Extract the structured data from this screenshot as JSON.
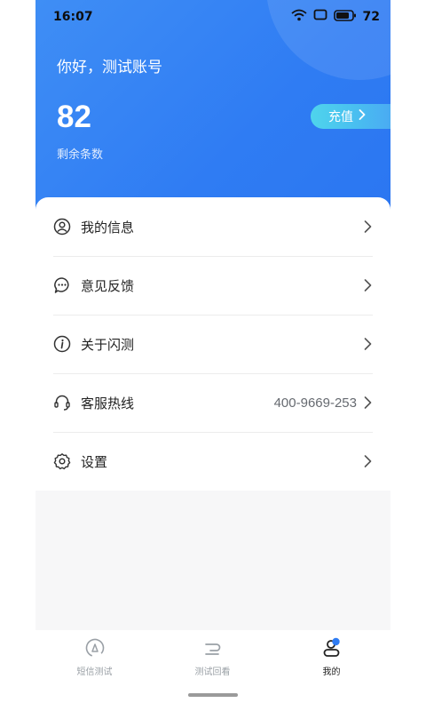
{
  "status_bar": {
    "time": "16:07",
    "battery_level": "72"
  },
  "header": {
    "greeting": "你好，测试账号",
    "remaining_count": "82",
    "remaining_label": "剩余条数",
    "recharge_label": "充值"
  },
  "menu": [
    {
      "label": "我的信息",
      "icon": "user-icon",
      "value": ""
    },
    {
      "label": "意见反馈",
      "icon": "message-icon",
      "value": ""
    },
    {
      "label": "关于闪测",
      "icon": "info-icon",
      "value": ""
    },
    {
      "label": "客服热线",
      "icon": "headset-icon",
      "value": "400-9669-253"
    },
    {
      "label": "设置",
      "icon": "gear-icon",
      "value": ""
    }
  ],
  "tabs": [
    {
      "label": "短信测试",
      "icon": "sms-test-icon",
      "active": false
    },
    {
      "label": "测试回看",
      "icon": "replay-icon",
      "active": false
    },
    {
      "label": "我的",
      "icon": "profile-icon",
      "active": true
    }
  ],
  "colors": {
    "header_blue": "#2f7cf3",
    "recharge_gradient_start": "#4fd4ec",
    "active_tab_accent": "#2f7cf3"
  }
}
